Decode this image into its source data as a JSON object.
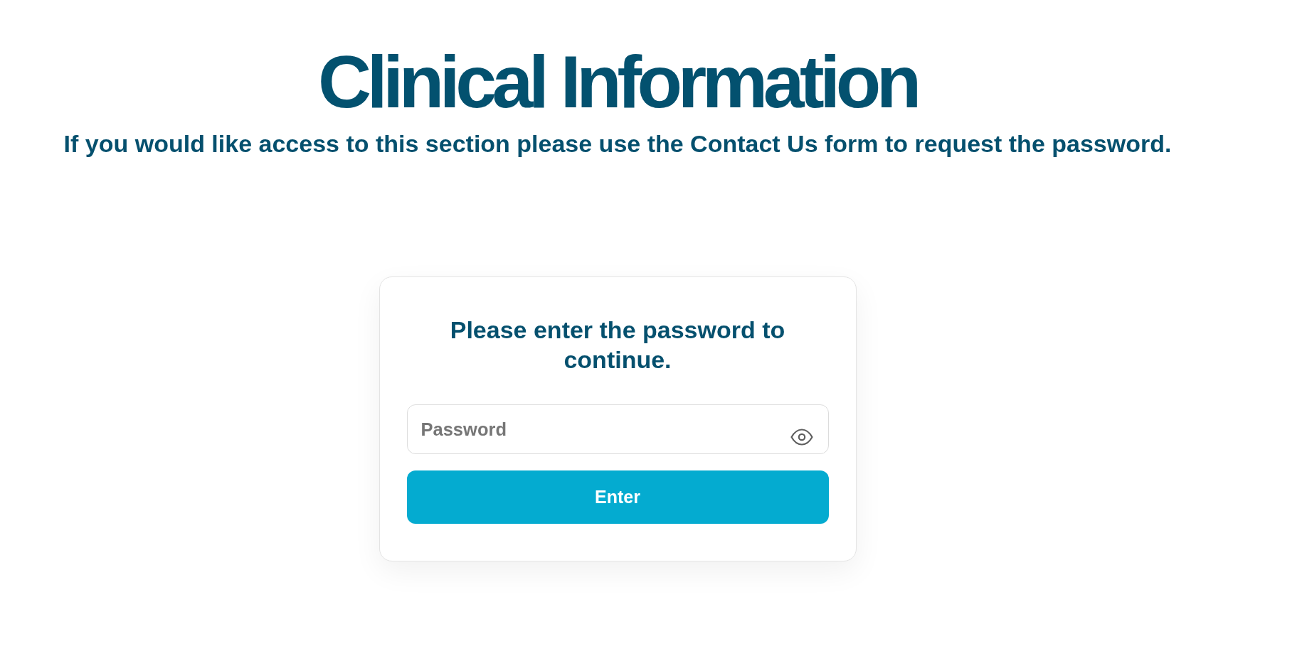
{
  "page": {
    "title": "Clinical Information",
    "subtitle": "If you would like access to this section please use the Contact Us form to request the password."
  },
  "password_card": {
    "heading": "Please enter the password to continue.",
    "password_field": {
      "placeholder": "Password"
    },
    "submit_button": {
      "label": "Enter"
    }
  }
}
